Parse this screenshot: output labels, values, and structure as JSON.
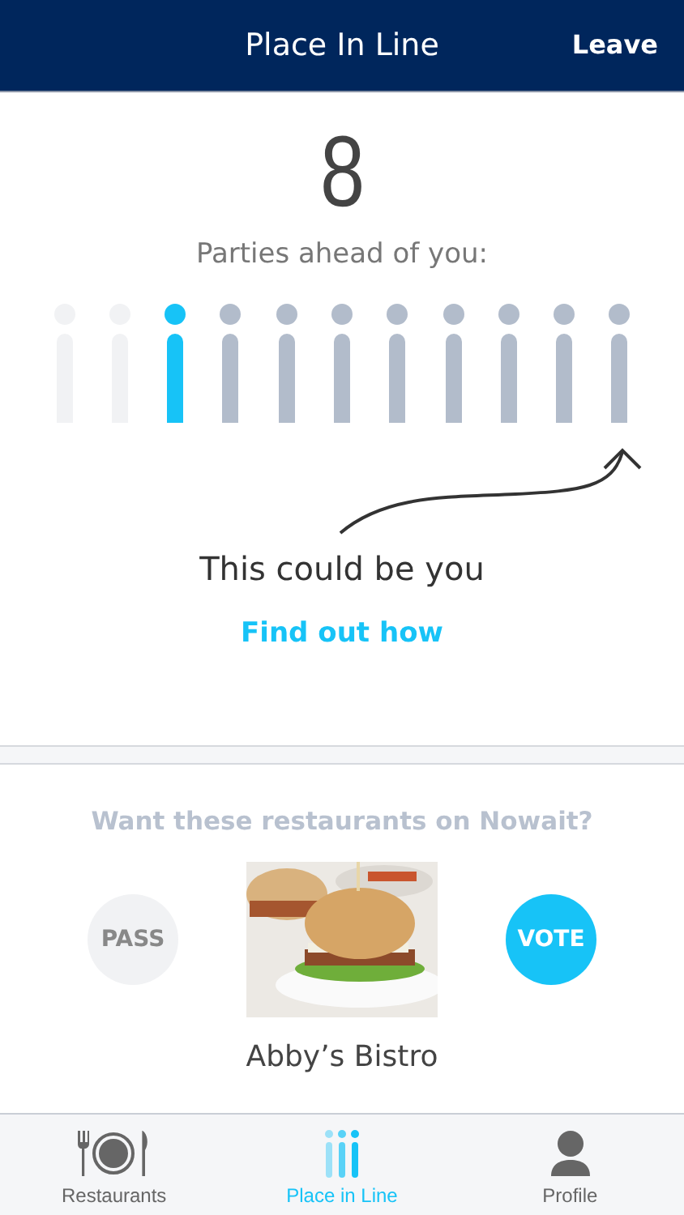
{
  "header": {
    "title": "Place In Line",
    "action": "Leave"
  },
  "queue": {
    "count": "8",
    "label": "Parties ahead of you:",
    "people": [
      {
        "kind": "passed"
      },
      {
        "kind": "passed"
      },
      {
        "kind": "you"
      },
      {
        "kind": "ahead"
      },
      {
        "kind": "ahead"
      },
      {
        "kind": "ahead"
      },
      {
        "kind": "ahead"
      },
      {
        "kind": "ahead"
      },
      {
        "kind": "ahead"
      },
      {
        "kind": "ahead"
      },
      {
        "kind": "ahead"
      }
    ],
    "caption": "This could be you",
    "link": "Find out how"
  },
  "vote": {
    "heading": "Want these restaurants on Nowait?",
    "pass": "PASS",
    "vote": "VOTE",
    "restaurant": "Abby’s Bistro"
  },
  "tabs": [
    {
      "label": "Restaurants",
      "kind": "restaurants",
      "selected": false
    },
    {
      "label": "Place in Line",
      "kind": "line",
      "selected": true
    },
    {
      "label": "Profile",
      "kind": "profile",
      "selected": false
    }
  ]
}
